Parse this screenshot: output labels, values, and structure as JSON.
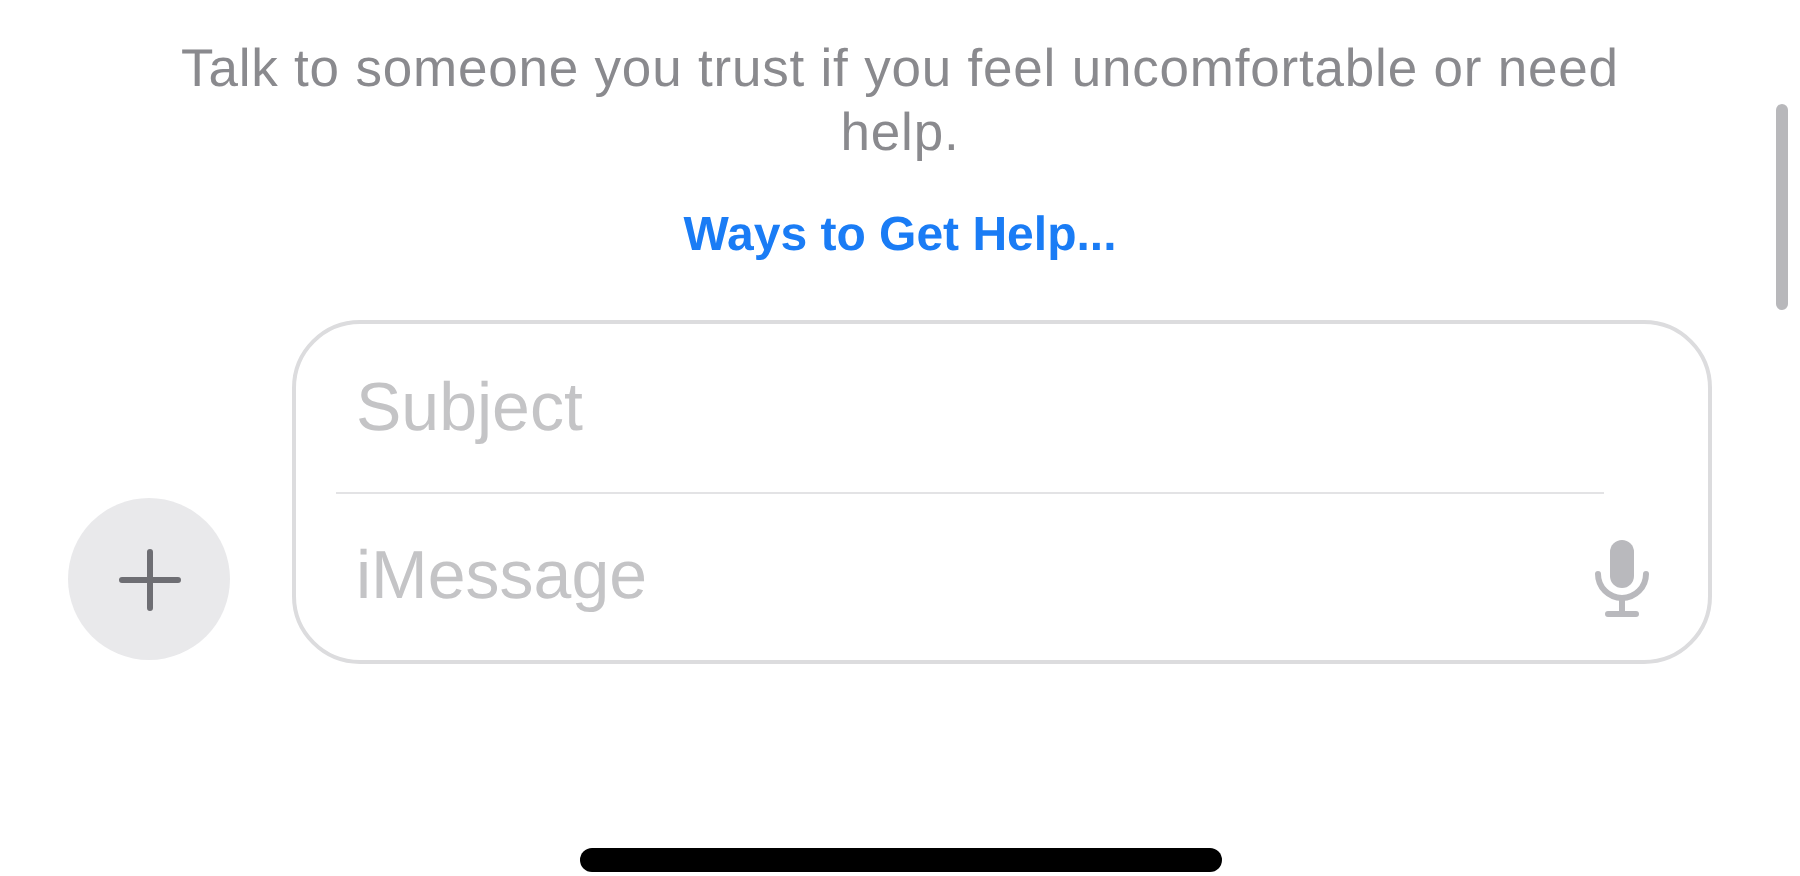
{
  "notice": {
    "text": "Talk to someone you trust if you feel uncomfortable or need help.",
    "link": "Ways to Get Help..."
  },
  "compose": {
    "subject": {
      "placeholder": "Subject"
    },
    "message": {
      "placeholder": "iMessage"
    }
  }
}
